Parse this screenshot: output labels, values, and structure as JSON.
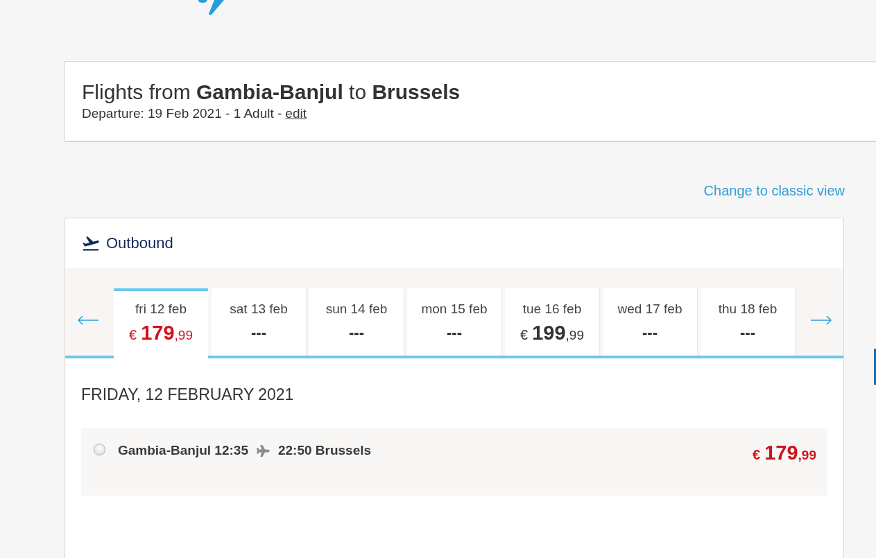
{
  "header": {
    "title": "Flights from **Gambia-Banjul** to **Brussels**",
    "summary": "Departure: 19 Feb 2021 - 1 Adult -",
    "edit_link": "edit"
  },
  "view_link": "Change to classic view",
  "outbound": {
    "title": "Outbound",
    "dates": [
      {
        "label": "fri 12 feb",
        "selected": true,
        "price": {
          "currency": "€",
          "whole": "179",
          "cents": ",99"
        }
      },
      {
        "label": "sat 13 feb",
        "selected": false,
        "price_placeholder": "---"
      },
      {
        "label": "sun 14 feb",
        "selected": false,
        "price_placeholder": "---"
      },
      {
        "label": "mon 15 feb",
        "selected": false,
        "price_placeholder": "---"
      },
      {
        "label": "tue 16 feb",
        "selected": false,
        "price": {
          "currency": "€",
          "whole": "199",
          "cents": ",99"
        }
      },
      {
        "label": "wed 17 feb",
        "selected": false,
        "price_placeholder": "---"
      },
      {
        "label": "thu 18 feb",
        "selected": false,
        "price_placeholder": "---"
      }
    ],
    "day_heading": "FRIDAY, 12 FEBRUARY 2021",
    "flights": [
      {
        "selected": false,
        "departure": "Gambia-Banjul 12:35",
        "arrival": "22:50 Brussels",
        "price": {
          "currency": "€",
          "whole": "179",
          "cents": ",99"
        }
      }
    ]
  }
}
